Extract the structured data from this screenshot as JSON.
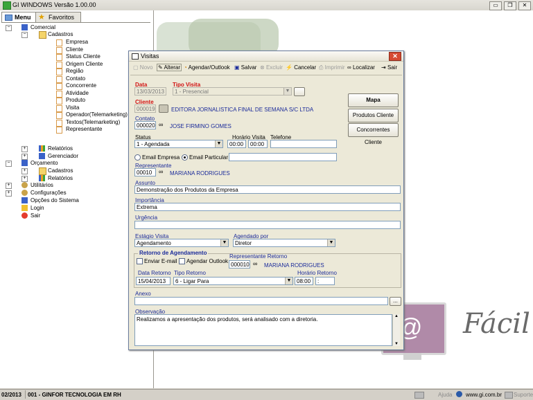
{
  "app": {
    "title": "GI WINDOWS  Versão  1.00.00",
    "window_buttons": [
      "▭",
      "❐",
      "✕"
    ]
  },
  "left_tabs": {
    "menu": "Menu",
    "favoritos": "Favoritos"
  },
  "tree": {
    "comercial": "Comercial",
    "cadastros": "Cadastros",
    "cad_items": [
      "Empresa",
      "Cliente",
      "Status Cliente",
      "Origem Cliente",
      "Região",
      "Contato",
      "Concorrente",
      "Atividade",
      "Produto",
      "Visita",
      "Operador(Telemarketing)",
      "Textos(Telemarketing)",
      "Representante"
    ],
    "relatorios": "Relatórios",
    "gerenciador": "Gerenciador",
    "orcamento": "Orçamento",
    "orc_cadastros": "Cadastros",
    "orc_relatorios": "Relatórios",
    "utilitarios": "Utilitários",
    "configuracoes": "Configurações",
    "opcoes": "Opções do Sistema",
    "login": "Login",
    "sair": "Sair"
  },
  "background": {
    "brand_text": "Fácil"
  },
  "status": {
    "date": "02/2013",
    "company": "001 - GINFOR TECNOLOGIA EM RH",
    "ajuda": "Ajuda",
    "site": "www.gi.com.br",
    "suporte": "Suporte"
  },
  "dialog": {
    "title": "Visitas",
    "close": "✕",
    "toolbar": {
      "novo": "Novo",
      "alterar": "Alterar",
      "agendar": "Agendar/Outlook",
      "salvar": "Salvar",
      "excluir": "Excluir",
      "cancelar": "Cancelar",
      "imprimir": "Imprimir",
      "localizar": "Localizar",
      "sair": "Sair"
    },
    "labels": {
      "data": "Data",
      "tipo_visita": "Tipo Visita",
      "cliente": "Cliente",
      "contato": "Contato",
      "status": "Status",
      "horario_visita": "Horário Visita",
      "telefone": "Telefone",
      "email_empresa": "Email Empresa",
      "email_particular": "Email Particular",
      "representante": "Representante",
      "assunto": "Assunto",
      "importancia": "Importância",
      "urgencia": "Urgência",
      "estagio": "Estágio Visita",
      "agendado_por": "Agendado por",
      "retorno": "Retorno de Agendamento",
      "enviar_email": "Enviar E-mail",
      "agendar_outlook": "Agendar Outlook",
      "rep_retorno": "Representante Retorno",
      "data_retorno": "Data Retorno",
      "tipo_retorno": "Tipo Retorno",
      "horario_retorno": "Horário Retorno",
      "anexo": "Anexo",
      "observacao": "Observação"
    },
    "values": {
      "data": "13/03/2013",
      "tipo_visita": "1 - Presencial",
      "cliente_code": "000019",
      "cliente_name": "EDITORA JORNALISTICA FINAL DE SEMANA S/C LTDA",
      "contato_code": "000020",
      "contato_name": "JOSE FIRMINO GOMES",
      "status": "1 - Agendada",
      "hora_ini": "00:00",
      "hora_fim": "00:00",
      "telefone": "",
      "email": "",
      "rep_code": "00010",
      "rep_name": "MARIANA RODRIGUES",
      "assunto": "Demonstração dos Produtos da Empresa",
      "importancia": "Extrema",
      "urgencia": "",
      "estagio": "Agendamento",
      "agendado_por": "Diretor",
      "rep_ret_code": "000010",
      "rep_ret_name": "MARIANA RODRIGUES",
      "data_retorno": "15/04/2013",
      "tipo_retorno": "6 - Ligar Para",
      "hora_ret_ini": "08:00",
      "hora_ret_fim": ":",
      "anexo": "",
      "anexo_btn": "...",
      "observacao": "Realizamos a apresentação dos produtos, será analisado com a diretoria."
    },
    "side_buttons": {
      "mapa": "Mapa",
      "produtos": "Produtos Cliente",
      "concorrentes": "Concorrentes Cliente"
    }
  }
}
